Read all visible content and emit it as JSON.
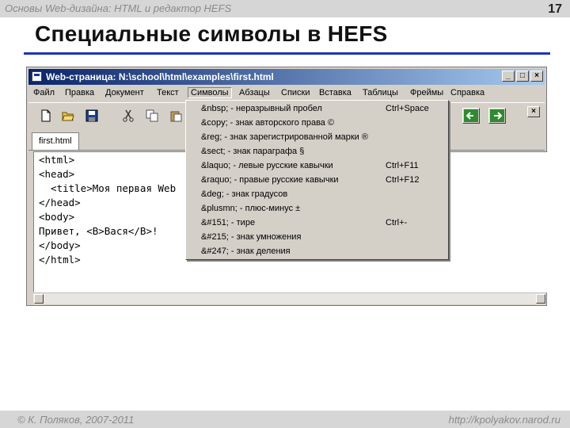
{
  "slide": {
    "header": "Основы Web-дизайна: HTML и редактор HEFS",
    "number": "17",
    "title": "Специальные символы в HEFS",
    "footer_left": "© К. Поляков, 2007-2011",
    "footer_right": "http://kpolyakov.narod.ru"
  },
  "window": {
    "title": "Web-страница: N:\\school\\html\\examples\\first.html",
    "buttons": [
      "_",
      "□",
      "×"
    ]
  },
  "menu": [
    "Файл",
    "Правка",
    "Документ",
    "Текст",
    "Символы",
    "Абзацы",
    "Списки",
    "Вставка",
    "Таблицы",
    "Фреймы",
    "Справка"
  ],
  "toolbar": {
    "icons": [
      "new-document-icon",
      "open-folder-icon",
      "save-disk-icon",
      "cut-scissors-icon",
      "copy-icon",
      "paste-icon"
    ],
    "close_label": "×"
  },
  "tab": {
    "label": "first.html"
  },
  "code_lines": [
    "<html>",
    "<head>",
    "  <title>Моя первая Web",
    "</head>",
    "<body>",
    "Привет, <B>Вася</B>!",
    "</body>",
    "</html>"
  ],
  "dropdown": [
    {
      "label": "&nbsp; - неразрывный пробел",
      "shortcut": "Ctrl+Space"
    },
    {
      "label": "&copy; - знак авторского права ©",
      "shortcut": ""
    },
    {
      "label": "&reg; - знак зарегистрированной марки ®",
      "shortcut": ""
    },
    {
      "label": "&sect; - знак параграфа §",
      "shortcut": ""
    },
    {
      "label": "&laquo; - левые русские кавычки",
      "shortcut": "Ctrl+F11"
    },
    {
      "label": "&raquo; - правые русские кавычки",
      "shortcut": "Ctrl+F12"
    },
    {
      "label": "&deg; - знак градусов",
      "shortcut": ""
    },
    {
      "label": "&plusmn; - плюс-минус ±",
      "shortcut": ""
    },
    {
      "label": "&#151; - тире",
      "shortcut": "Ctrl+-"
    },
    {
      "label": "&#215; - знак умножения",
      "shortcut": ""
    },
    {
      "label": "&#247; - знак деления",
      "shortcut": ""
    }
  ],
  "colors": {
    "title_bar": "#0a246a",
    "title_rule": "#2233bb",
    "nav_arrow": "#2e8b2e"
  }
}
